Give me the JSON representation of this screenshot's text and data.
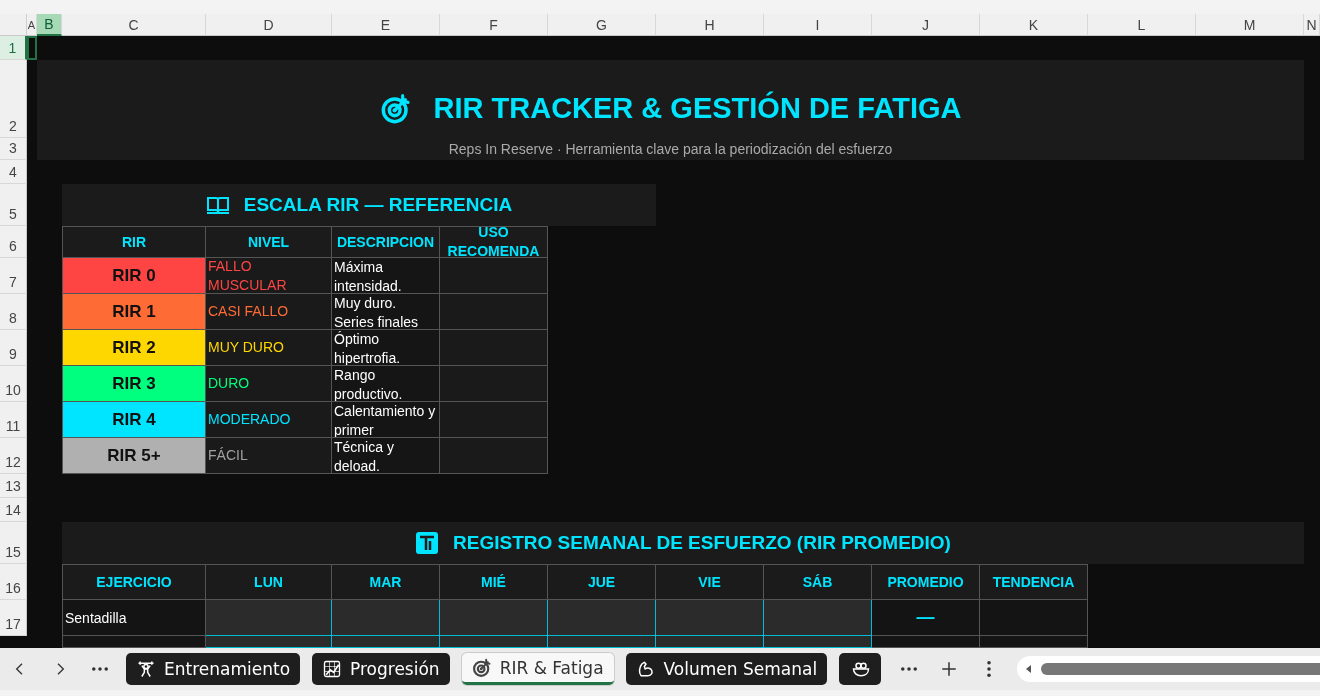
{
  "column_headers": [
    {
      "label": "A",
      "selected": false
    },
    {
      "label": "B",
      "selected": true
    },
    {
      "label": "C",
      "selected": false
    },
    {
      "label": "D",
      "selected": false
    },
    {
      "label": "E",
      "selected": false
    },
    {
      "label": "F",
      "selected": false
    },
    {
      "label": "G",
      "selected": false
    },
    {
      "label": "H",
      "selected": false
    },
    {
      "label": "I",
      "selected": false
    },
    {
      "label": "J",
      "selected": false
    },
    {
      "label": "K",
      "selected": false
    },
    {
      "label": "L",
      "selected": false
    },
    {
      "label": "M",
      "selected": false
    },
    {
      "label": "N",
      "selected": false
    }
  ],
  "row_headers": [
    {
      "label": "1",
      "selected": true
    },
    {
      "label": "2",
      "selected": false
    },
    {
      "label": "3",
      "selected": false
    },
    {
      "label": "4",
      "selected": false
    },
    {
      "label": "5",
      "selected": false
    },
    {
      "label": "6",
      "selected": false
    },
    {
      "label": "7",
      "selected": false
    },
    {
      "label": "8",
      "selected": false
    },
    {
      "label": "9",
      "selected": false
    },
    {
      "label": "10",
      "selected": false
    },
    {
      "label": "11",
      "selected": false
    },
    {
      "label": "12",
      "selected": false
    },
    {
      "label": "13",
      "selected": false
    },
    {
      "label": "14",
      "selected": false
    },
    {
      "label": "15",
      "selected": false
    },
    {
      "label": "16",
      "selected": false
    },
    {
      "label": "17",
      "selected": false
    }
  ],
  "title": "RIR TRACKER & GESTIÓN DE FATIGA",
  "subtitle": "Reps In Reserve · Herramienta clave para la periodización del esfuerzo",
  "scale": {
    "title": "ESCALA RIR — REFERENCIA",
    "columns": [
      "RIR",
      "NIVEL",
      "DESCRIPCION",
      "USO RECOMENDA"
    ],
    "rows": [
      {
        "rir": "RIR 0",
        "level": "FALLO MUSCULAR",
        "description": "Máxima intensidad.",
        "color": "#ff4444"
      },
      {
        "rir": "RIR 1",
        "level": "CASI FALLO",
        "description": "Muy duro. Series finales",
        "color": "#ff6b35"
      },
      {
        "rir": "RIR 2",
        "level": "MUY DURO",
        "description": "Óptimo hipertrofia.",
        "color": "#ffd700"
      },
      {
        "rir": "RIR 3",
        "level": "DURO",
        "description": "Rango productivo.",
        "color": "#00ff7f"
      },
      {
        "rir": "RIR 4",
        "level": "MODERADO",
        "description": "Calentamiento y primer",
        "color": "#00e5ff"
      },
      {
        "rir": "RIR 5+",
        "level": "FÁCIL",
        "description": "Técnica y deload.",
        "color": "#b0b0b0"
      }
    ]
  },
  "weekly": {
    "title": "REGISTRO SEMANAL DE ESFUERZO (RIR PROMEDIO)",
    "columns": [
      "EJERCICIO",
      "LUN",
      "MAR",
      "MIÉ",
      "JUE",
      "VIE",
      "SÁB",
      "PROMEDIO",
      "TENDENCIA"
    ],
    "rows": [
      {
        "exercise": "Sentadilla",
        "average": "—"
      }
    ]
  },
  "sheet_tabs": [
    {
      "label": "Entrenamiento",
      "selected": false
    },
    {
      "label": "Progresión",
      "selected": false
    },
    {
      "label": "RIR & Fatiga",
      "selected": true
    },
    {
      "label": "Volumen Semanal",
      "selected": false
    },
    {
      "selected": false
    }
  ]
}
